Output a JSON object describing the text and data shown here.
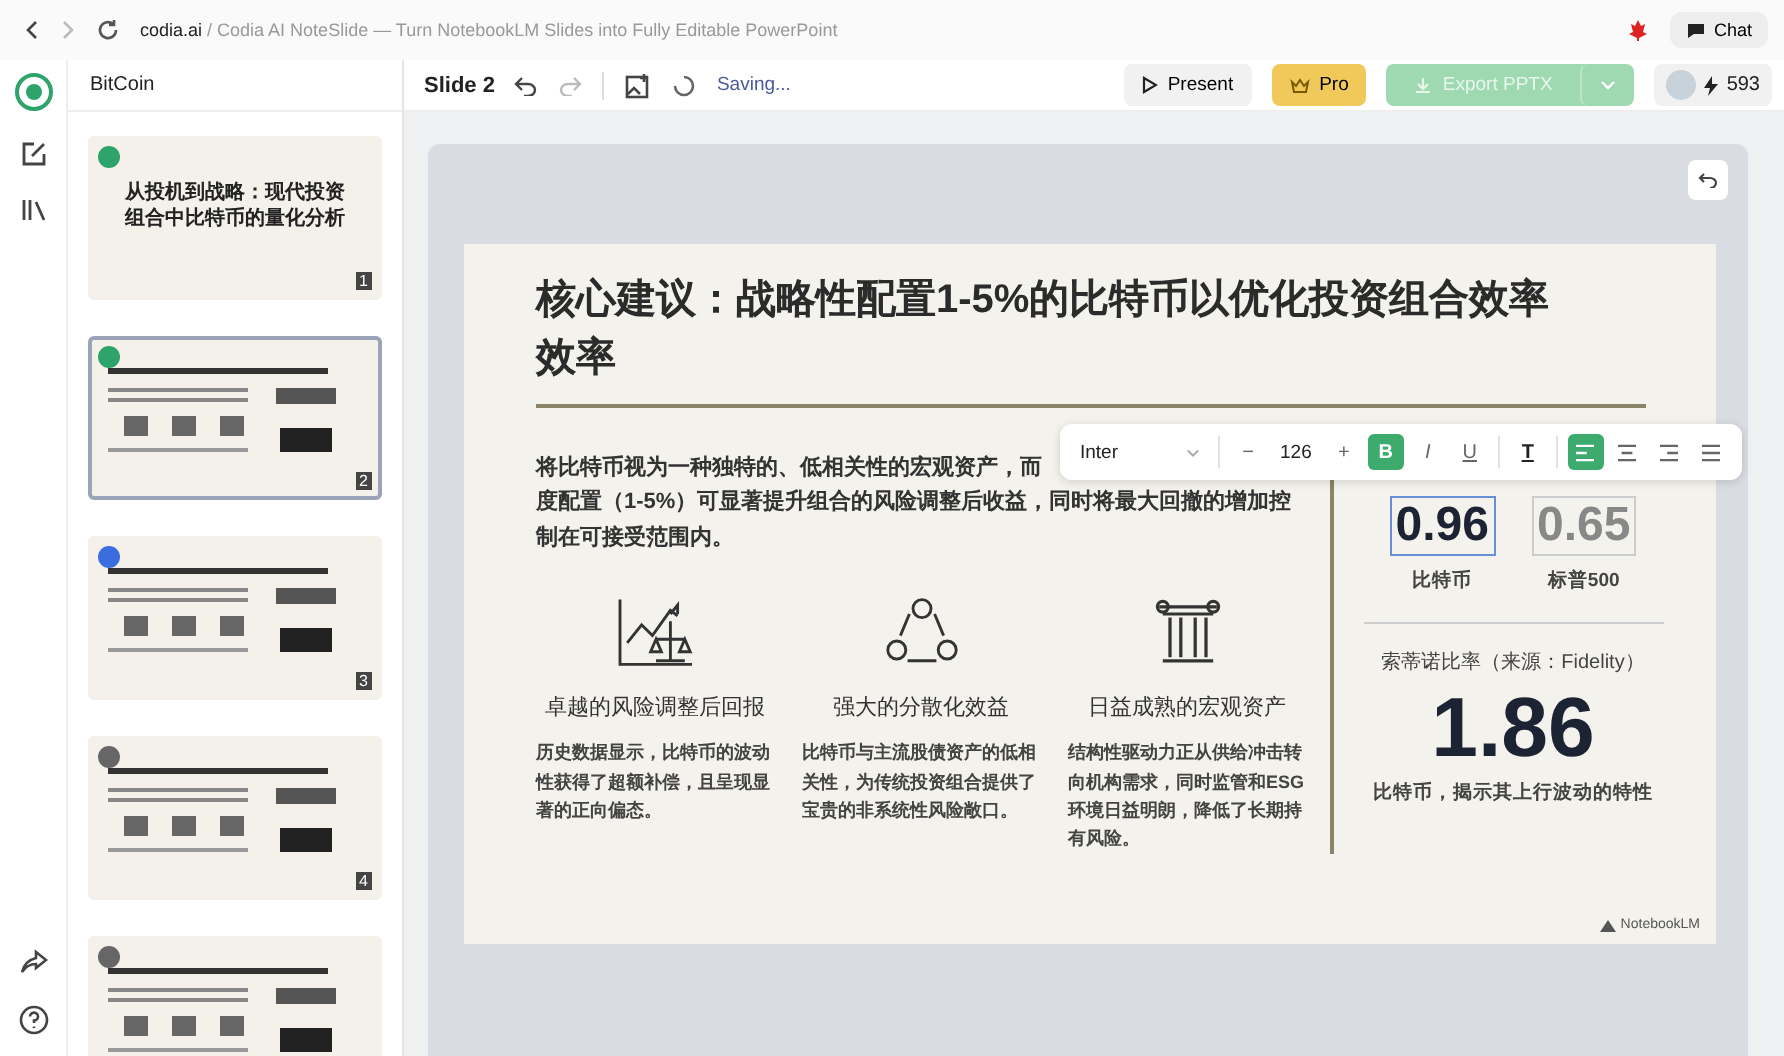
{
  "browser": {
    "domain": "codia.ai",
    "path": " / Codia AI NoteSlide — Turn NotebookLM Slides into Fully Editable PowerPoint",
    "chat": "Chat"
  },
  "header": {
    "project": "BitCoin",
    "slide": "Slide 2",
    "status": "Saving...",
    "present": "Present",
    "pro": "Pro",
    "export": "Export PPTX",
    "credits": "593"
  },
  "thumbnails": [
    {
      "number": "1",
      "selected": false,
      "kind": "done",
      "title": "从投机到战略：现代投资组合中比特币的量化分析"
    },
    {
      "number": "2",
      "selected": true,
      "kind": "done"
    },
    {
      "number": "3",
      "selected": false,
      "kind": "working"
    },
    {
      "number": "4",
      "selected": false,
      "kind": "pending"
    },
    {
      "selected": false,
      "kind": "pending"
    }
  ],
  "toolbar": {
    "font": "Inter",
    "size": "126",
    "minus": "−",
    "plus": "+",
    "buttons": [
      {
        "kind": "bold",
        "label": "B",
        "selected": true
      },
      {
        "kind": "italic",
        "label": "I",
        "selected": false
      },
      {
        "kind": "underline",
        "label": "U",
        "selected": false
      },
      {
        "kind": "color",
        "label": "T",
        "selected": false
      },
      {
        "kind": "align-left",
        "selected": true
      },
      {
        "kind": "align-center",
        "selected": false
      },
      {
        "kind": "align-right",
        "selected": false
      },
      {
        "kind": "justify",
        "selected": false
      }
    ]
  },
  "slide": {
    "title": "核心建议：战略性配置1-5%的比特币以优化投资组合效率效率",
    "intro_visible": "将比特币视为一种独特的、低相关性的宏观资产，而",
    "intro_rest": "度配置（1-5%）可显著提升组合的风险调整后收益，同时将最大回撤的增加控制在可接受范围内。",
    "features": [
      {
        "kind": "chart-scale",
        "title": "卓越的风险调整后回报",
        "text": "历史数据显示，比特币的波动性获得了超额补偿，且呈现显著的正向偏态。"
      },
      {
        "kind": "cycle",
        "title": "强大的分散化效益",
        "text": "比特币与主流股债资产的低相关性，为传统投资组合提供了宝贵的非系统性风险敞口。"
      },
      {
        "kind": "pillar",
        "title": "日益成熟的宏观资产",
        "text": "结构性驱动力正从供给冲击转向机构需求，同时监管和ESG环境日益明朗，降低了长期持有风险。"
      }
    ],
    "stats": [
      {
        "value": "0.96",
        "label": "比特币",
        "selected": true
      },
      {
        "value": "0.65",
        "label": "标普500",
        "selected": false
      }
    ],
    "sortino_title": "索蒂诺比率（来源：Fidelity）",
    "sortino_value": "1.86",
    "sortino_caption": "比特币，揭示其上行波动的特性",
    "brand": "NotebookLM"
  }
}
